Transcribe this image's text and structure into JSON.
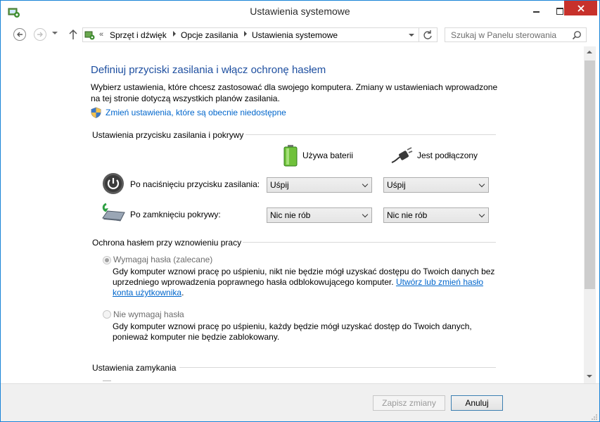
{
  "window": {
    "title": "Ustawienia systemowe",
    "accent_color": "#1883d7",
    "close_color": "#c7312b"
  },
  "navbar": {
    "breadcrumbs": [
      "Sprzęt i dźwięk",
      "Opcje zasilania",
      "Ustawienia systemowe"
    ],
    "overflow": "«",
    "search_placeholder": "Szukaj w Panelu sterowania"
  },
  "main": {
    "heading": "Definiuj przyciski zasilania i włącz ochronę hasłem",
    "intro": "Wybierz ustawienia, które chcesz zastosować dla swojego komputera. Zmiany w ustawieniach wprowadzone na tej stronie dotyczą wszystkich planów zasilania.",
    "change_unavailable_link": "Zmień ustawienia, które są obecnie niedostępne",
    "power_section": {
      "title": "Ustawienia przycisku zasilania i pokrywy",
      "col_battery": "Używa baterii",
      "col_plugged": "Jest podłączony",
      "rows": [
        {
          "label": "Po naciśnięciu przycisku zasilania:",
          "battery": "Uśpij",
          "plugged": "Uśpij",
          "icon": "power-icon"
        },
        {
          "label": "Po zamknięciu pokrywy:",
          "battery": "Nic nie rób",
          "plugged": "Nic nie rób",
          "icon": "laptop-lid-icon"
        }
      ]
    },
    "password_section": {
      "title": "Ochrona hasłem przy wznowieniu pracy",
      "require_label": "Wymagaj hasła (zalecane)",
      "require_desc": "Gdy komputer wznowi pracę po uśpieniu, nikt nie będzie mógł uzyskać dostępu do Twoich danych bez uprzedniego wprowadzenia poprawnego hasła odblokowującego komputer.",
      "require_link": "Utwórz lub zmień hasło konta użytkownika",
      "require_end": ".",
      "no_require_label": "Nie wymagaj hasła",
      "no_require_desc": "Gdy komputer wznowi pracę po uśpieniu, każdy będzie mógł uzyskać dostęp do Twoich danych, ponieważ komputer nie będzie zablokowany."
    },
    "shutdown_section": {
      "title": "Ustawienia zamykania"
    }
  },
  "footer": {
    "save_label": "Zapisz zmiany",
    "cancel_label": "Anuluj"
  }
}
